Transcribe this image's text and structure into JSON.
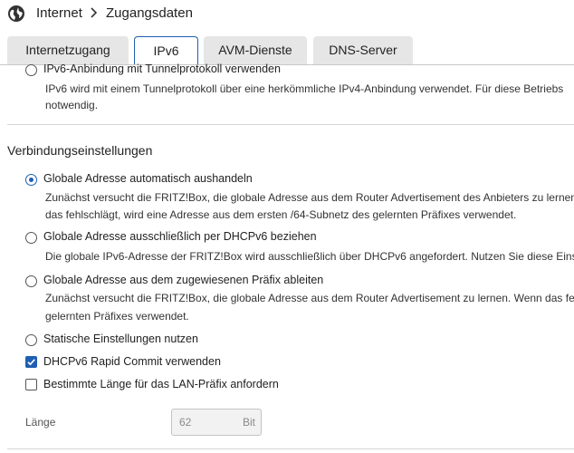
{
  "header": {
    "breadcrumb": [
      "Internet",
      "Zugangsdaten"
    ]
  },
  "tabs": [
    {
      "label": "Internetzugang",
      "active": false
    },
    {
      "label": "IPv6",
      "active": true
    },
    {
      "label": "AVM-Dienste",
      "active": false
    },
    {
      "label": "DNS-Server",
      "active": false
    }
  ],
  "tunnel": {
    "label": "IPv6-Anbindung mit Tunnelprotokoll verwenden",
    "desc": [
      "IPv6 wird mit einem Tunnelprotokoll über eine herkömmliche IPv4-Anbindung verwendet. Für diese Betriebs",
      "notwendig."
    ]
  },
  "section_title": "Verbindungseinstellungen",
  "options": [
    {
      "label": "Globale Adresse automatisch aushandeln",
      "checked": true,
      "desc": [
        "Zunächst versucht die FRITZ!Box, die globale Adresse aus dem Router Advertisement des Anbieters zu lernen",
        "das fehlschlägt, wird eine Adresse aus dem ersten /64-Subnetz des gelernten Präfixes verwendet."
      ]
    },
    {
      "label": "Globale Adresse ausschließlich per DHCPv6 beziehen",
      "checked": false,
      "desc": [
        "Die globale IPv6-Adresse der FRITZ!Box wird ausschließlich über DHCPv6 angefordert. Nutzen Sie diese Einst"
      ]
    },
    {
      "label": "Globale Adresse aus dem zugewiesenen Präfix ableiten",
      "checked": false,
      "desc": [
        "Zunächst versucht die FRITZ!Box, die globale Adresse aus dem Router Advertisement zu lernen. Wenn das fe",
        "gelernten Präfixes verwendet."
      ]
    },
    {
      "label": "Statische Einstellungen nutzen",
      "checked": false,
      "desc": []
    }
  ],
  "checkboxes": [
    {
      "label": "DHCPv6 Rapid Commit verwenden",
      "checked": true
    },
    {
      "label": "Bestimmte Länge für das LAN-Präfix anfordern",
      "checked": false
    }
  ],
  "length": {
    "label": "Länge",
    "value": "62",
    "unit": "Bit"
  },
  "colors": {
    "accent": "#1f5fb3"
  }
}
